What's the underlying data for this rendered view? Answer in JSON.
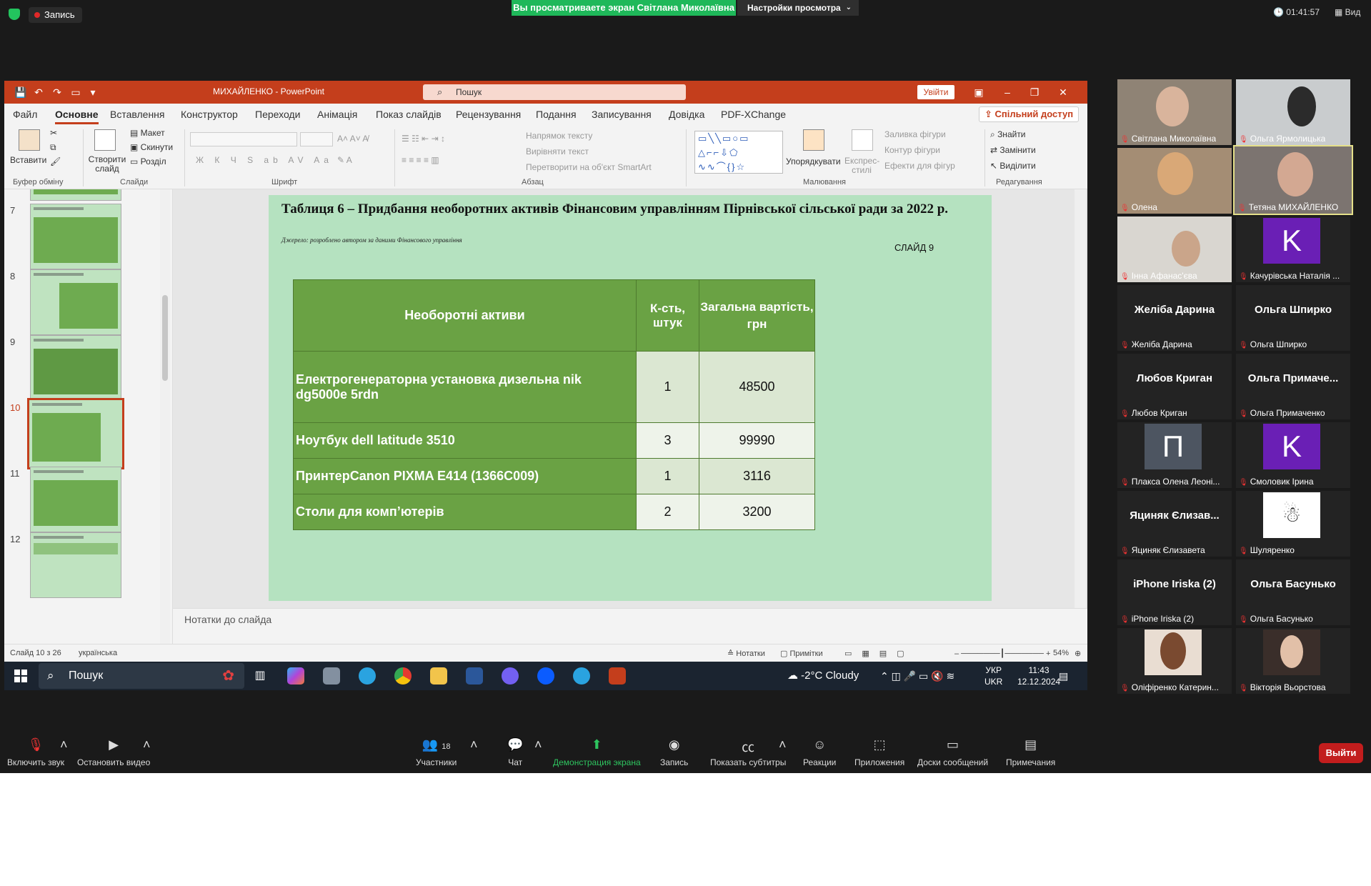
{
  "zoom": {
    "record_label": "Запись",
    "viewing_banner": "Вы просматриваете экран Світлана Миколаївна",
    "view_settings": "Настройки просмотра",
    "timer": "01:41:57",
    "view_label": "Вид",
    "accent_green": "#1fb85a"
  },
  "ppt": {
    "doc_title": "МИХАЙЛЕНКО  -  PowerPoint",
    "search_placeholder": "Пошук",
    "signin": "Увійти",
    "tabs": [
      "Файл",
      "Основне",
      "Вставлення",
      "Конструктор",
      "Переходи",
      "Анімація",
      "Показ слайдів",
      "Рецензування",
      "Подання",
      "Записування",
      "Довідка",
      "PDF-XChange"
    ],
    "active_tab": "Основне",
    "share": "Спільний доступ",
    "ribbon": {
      "paste": "Вставити",
      "new_slide": "Створити слайд",
      "layout": "Макет",
      "reset": "Скинути",
      "section": "Розділ",
      "text_direction": "Напрямок тексту",
      "align_text": "Вирівняти текст",
      "smartart": "Перетворити на об'єкт SmartArt",
      "arrange": "Упорядкувати",
      "quick_styles": "Експрес-стилі",
      "shape_fill": "Заливка фігури",
      "shape_outline": "Контур фігури",
      "shape_effects": "Ефекти для фігур",
      "find": "Знайти",
      "replace": "Замінити",
      "select": "Виділити",
      "groups": [
        "Буфер обміну",
        "Слайди",
        "Шрифт",
        "Абзац",
        "Малювання",
        "Редагування"
      ]
    },
    "thumbnails": [
      {
        "num": "7"
      },
      {
        "num": "8"
      },
      {
        "num": "9"
      },
      {
        "num": "10"
      },
      {
        "num": "11"
      },
      {
        "num": "12"
      }
    ],
    "selected_thumb": "10",
    "slide": {
      "title": "Таблиця 6  – Придбання необоротних активів Фінансовим управлінням Пірнівської сільської ради за 2022 р.",
      "source": "Джерело: розроблено автором  за даними Фінансового управління",
      "slide_label": "СЛАЙД 9",
      "table": {
        "headers": [
          "Необоротні активи",
          "К-сть, штук",
          "Загальна вартість, грн"
        ],
        "rows": [
          {
            "name": "Електрогенераторна установка дизельна nik dg5000e 5rdn",
            "qty": "1",
            "cost": "48500"
          },
          {
            "name": "Ноутбук dell latitude 3510",
            "qty": "3",
            "cost": "99990"
          },
          {
            "name": "ПринтерCanon PIXMA E414 (1366C009)",
            "qty": "1",
            "cost": "3116"
          },
          {
            "name": "Столи для комп’ютерів",
            "qty": "2",
            "cost": "3200"
          }
        ]
      }
    },
    "notes_placeholder": "Нотатки до слайда",
    "status": {
      "slide_of": "Слайд 10 з 26",
      "language": "українська",
      "notes": "Нотатки",
      "comments": "Примітки",
      "zoom": "54%"
    }
  },
  "taskbar": {
    "search": "Пошук",
    "weather": "-2°C  Cloudy",
    "lang_top": "УКР",
    "lang_bottom": "UKR",
    "time": "11:43",
    "date": "12.12.2024"
  },
  "participants": [
    {
      "name": "Світлана Миколаївна",
      "type": "video"
    },
    {
      "name": "Ольга Ярмолицька",
      "type": "video"
    },
    {
      "name": "Олена",
      "type": "video"
    },
    {
      "name": "Тетяна МИХАЙЛЕНКО",
      "type": "video",
      "active": true
    },
    {
      "name": "Інна Афанас'єва",
      "type": "video"
    },
    {
      "name": "Качурівська Наталія ...",
      "type": "avatar",
      "letter": "K",
      "color": "#6a1fb5"
    },
    {
      "name": "Желіба Дарина",
      "type": "name",
      "big": "Желіба Дарина"
    },
    {
      "name": "Ольга Шпирко",
      "type": "name",
      "big": "Ольга Шпирко"
    },
    {
      "name": "Любов Криган",
      "type": "name",
      "big": "Любов Криган"
    },
    {
      "name": "Ольга Примаченко",
      "type": "name",
      "big": "Ольга  Примаче..."
    },
    {
      "name": "Плакса Олена Леоні...",
      "type": "avatar",
      "letter": "П",
      "color": "#4d5561"
    },
    {
      "name": "Смоловик Ірина",
      "type": "avatar",
      "letter": "K",
      "color": "#6a1fb5"
    },
    {
      "name": "Яциняк Єлизавета",
      "type": "name",
      "big": "Яциняк Єлизав..."
    },
    {
      "name": "Шуляренко",
      "type": "image"
    },
    {
      "name": "iPhone Iriska (2)",
      "type": "name",
      "big": "iPhone Iriska (2)"
    },
    {
      "name": "Ольга Басунько",
      "type": "name",
      "big": "Ольга Басунько"
    },
    {
      "name": "Оліфіренко Катерин...",
      "type": "photo"
    },
    {
      "name": "Вікторія Вьорстова",
      "type": "photo"
    }
  ],
  "toolbar": {
    "mute": "Включить звук",
    "video": "Остановить видео",
    "participants": "Участники",
    "participants_count": "18",
    "chat": "Чат",
    "share": "Демонстрация экрана",
    "record": "Запись",
    "captions": "Показать субтитры",
    "reactions": "Реакции",
    "apps": "Приложения",
    "boards": "Доски сообщений",
    "notes": "Примечания",
    "leave": "Выйти"
  }
}
